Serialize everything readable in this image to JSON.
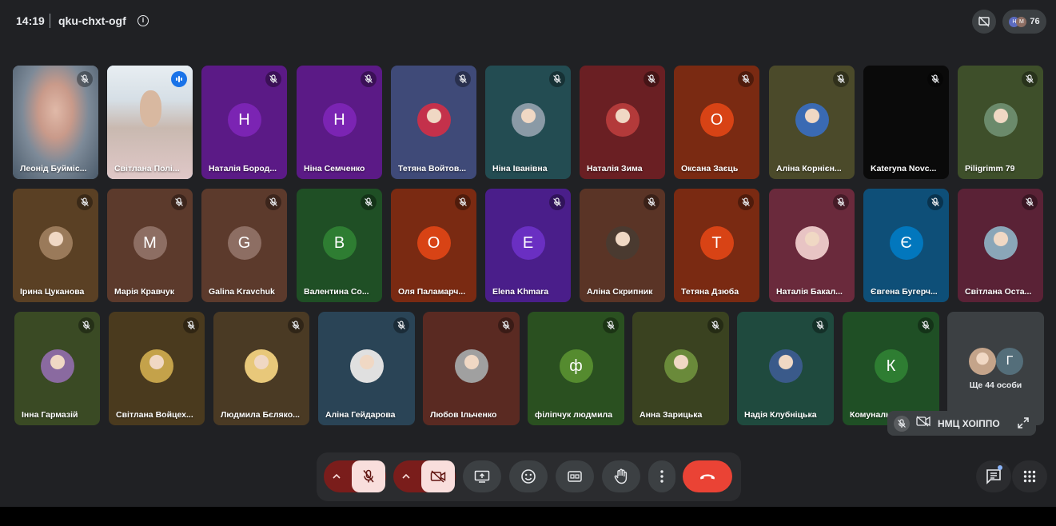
{
  "header": {
    "time": "14:19",
    "meeting_code": "qku-chxt-ogf",
    "info_icon": "info-icon",
    "participant_count": "76",
    "participant_avatars": [
      "Н",
      "М"
    ]
  },
  "participants": [
    {
      "name": "Леонід Буйміс...",
      "type": "photo",
      "bg": "#7a8a9a",
      "mic": "muted",
      "active": false
    },
    {
      "name": "Світлана Полі...",
      "type": "photo",
      "bg": "#c9d4dc",
      "mic": "speaking",
      "active": true
    },
    {
      "name": "Наталія Бород...",
      "type": "letter",
      "letter": "Н",
      "bg": "#5b1a86",
      "avatar_bg": "#7b24b3",
      "mic": "muted"
    },
    {
      "name": "Ніна Семченко",
      "type": "letter",
      "letter": "Н",
      "bg": "#5b1a86",
      "avatar_bg": "#7b24b3",
      "mic": "muted"
    },
    {
      "name": "Тетяна Войтов...",
      "type": "avatar",
      "bg": "#3f4a78",
      "avatar_bg": "#c4314b",
      "mic": "muted"
    },
    {
      "name": "Ніна Іванівна",
      "type": "avatar",
      "bg": "#234c52",
      "avatar_bg": "#8a9aa6",
      "mic": "muted"
    },
    {
      "name": "Наталія Зима",
      "type": "avatar",
      "bg": "#6a1f23",
      "avatar_bg": "#b33a3a",
      "mic": "muted"
    },
    {
      "name": "Оксана Заєць",
      "type": "letter",
      "letter": "О",
      "bg": "#7a2a12",
      "avatar_bg": "#d84315",
      "mic": "muted"
    },
    {
      "name": "Аліна Корнієн...",
      "type": "avatar",
      "bg": "#4b4a2a",
      "avatar_bg": "#3a6ab3",
      "mic": "muted"
    },
    {
      "name": "Kateryna Novc...",
      "type": "blank",
      "bg": "#0a0a0a",
      "mic": "muted"
    },
    {
      "name": "Piligrimm 79",
      "type": "avatar",
      "bg": "#3e4f2a",
      "avatar_bg": "#6b8a6b",
      "mic": "muted"
    },
    {
      "name": "Ірина Цуканова",
      "type": "avatar",
      "bg": "#5a4024",
      "avatar_bg": "#9a7a5a",
      "mic": "muted"
    },
    {
      "name": "Марія Кравчук",
      "type": "letter",
      "letter": "М",
      "bg": "#5c3a2c",
      "avatar_bg": "#8d6e63",
      "mic": "muted"
    },
    {
      "name": "Galina Kravchuk",
      "type": "letter",
      "letter": "G",
      "bg": "#5c3a2c",
      "avatar_bg": "#8d6e63",
      "mic": "muted"
    },
    {
      "name": "Валентина Со...",
      "type": "letter",
      "letter": "В",
      "bg": "#1f4f25",
      "avatar_bg": "#2e7d32",
      "mic": "muted"
    },
    {
      "name": "Оля Паламарч...",
      "type": "letter",
      "letter": "О",
      "bg": "#7a2a12",
      "avatar_bg": "#d84315",
      "mic": "muted"
    },
    {
      "name": "Elena Khmara",
      "type": "letter",
      "letter": "Е",
      "bg": "#4a1e8a",
      "avatar_bg": "#6a2fc2",
      "mic": "muted"
    },
    {
      "name": "Аліна Скрипник",
      "type": "avatar",
      "bg": "#5a3426",
      "avatar_bg": "#4a3a30",
      "mic": "muted"
    },
    {
      "name": "Тетяна Дзюба",
      "type": "letter",
      "letter": "Т",
      "bg": "#7a2a12",
      "avatar_bg": "#d84315",
      "mic": "muted"
    },
    {
      "name": "Наталія Бакал...",
      "type": "avatar",
      "bg": "#6a2a3c",
      "avatar_bg": "#e8c4c4",
      "mic": "muted"
    },
    {
      "name": "Євгена Бугерч...",
      "type": "letter",
      "letter": "Є",
      "bg": "#0e4f78",
      "avatar_bg": "#0277bd",
      "mic": "muted"
    },
    {
      "name": "Світлана Оста...",
      "type": "avatar",
      "bg": "#5a2236",
      "avatar_bg": "#8aa6b8",
      "mic": "muted"
    },
    {
      "name": "Інна Гармазій",
      "type": "avatar",
      "bg": "#3a4a24",
      "avatar_bg": "#8a6aa0",
      "mic": "muted"
    },
    {
      "name": "Світлана Войцех...",
      "type": "avatar",
      "bg": "#4a3a1e",
      "avatar_bg": "#c4a24a",
      "mic": "muted"
    },
    {
      "name": "Людмила Бєляко...",
      "type": "avatar",
      "bg": "#4a3a24",
      "avatar_bg": "#e8c87a",
      "mic": "muted"
    },
    {
      "name": "Аліна Гейдарова",
      "type": "avatar",
      "bg": "#2a4456",
      "avatar_bg": "#e0e0e0",
      "mic": "muted"
    },
    {
      "name": "Любов Ільченко",
      "type": "avatar",
      "bg": "#5a2a22",
      "avatar_bg": "#a0a0a0",
      "mic": "muted"
    },
    {
      "name": "філіпчук людмила",
      "type": "letter",
      "letter": "ф",
      "bg": "#2a5020",
      "avatar_bg": "#558b2f",
      "mic": "muted"
    },
    {
      "name": "Анна Зарицька",
      "type": "avatar",
      "bg": "#3a4220",
      "avatar_bg": "#6a8a3a",
      "mic": "muted"
    },
    {
      "name": "Надія Клубніцька",
      "type": "avatar",
      "bg": "#1f4a3e",
      "avatar_bg": "#3a5a8a",
      "mic": "muted"
    },
    {
      "name": "Комунальн...",
      "type": "letter",
      "letter": "К",
      "bg": "#1f4f25",
      "avatar_bg": "#2e7d32",
      "mic": "muted"
    }
  ],
  "more_tile": {
    "label": "Ще 44 особи",
    "avatar_letter": "Г",
    "avatar_bg": "#546e7a",
    "photo_bg": "#c4a48a"
  },
  "self_view": {
    "name": "НМЦ ХОІППО"
  },
  "controls": {
    "mic_state": "muted",
    "camera_state": "off",
    "accent_red": "#ea4335",
    "muted_bg": "#f9dedc"
  }
}
